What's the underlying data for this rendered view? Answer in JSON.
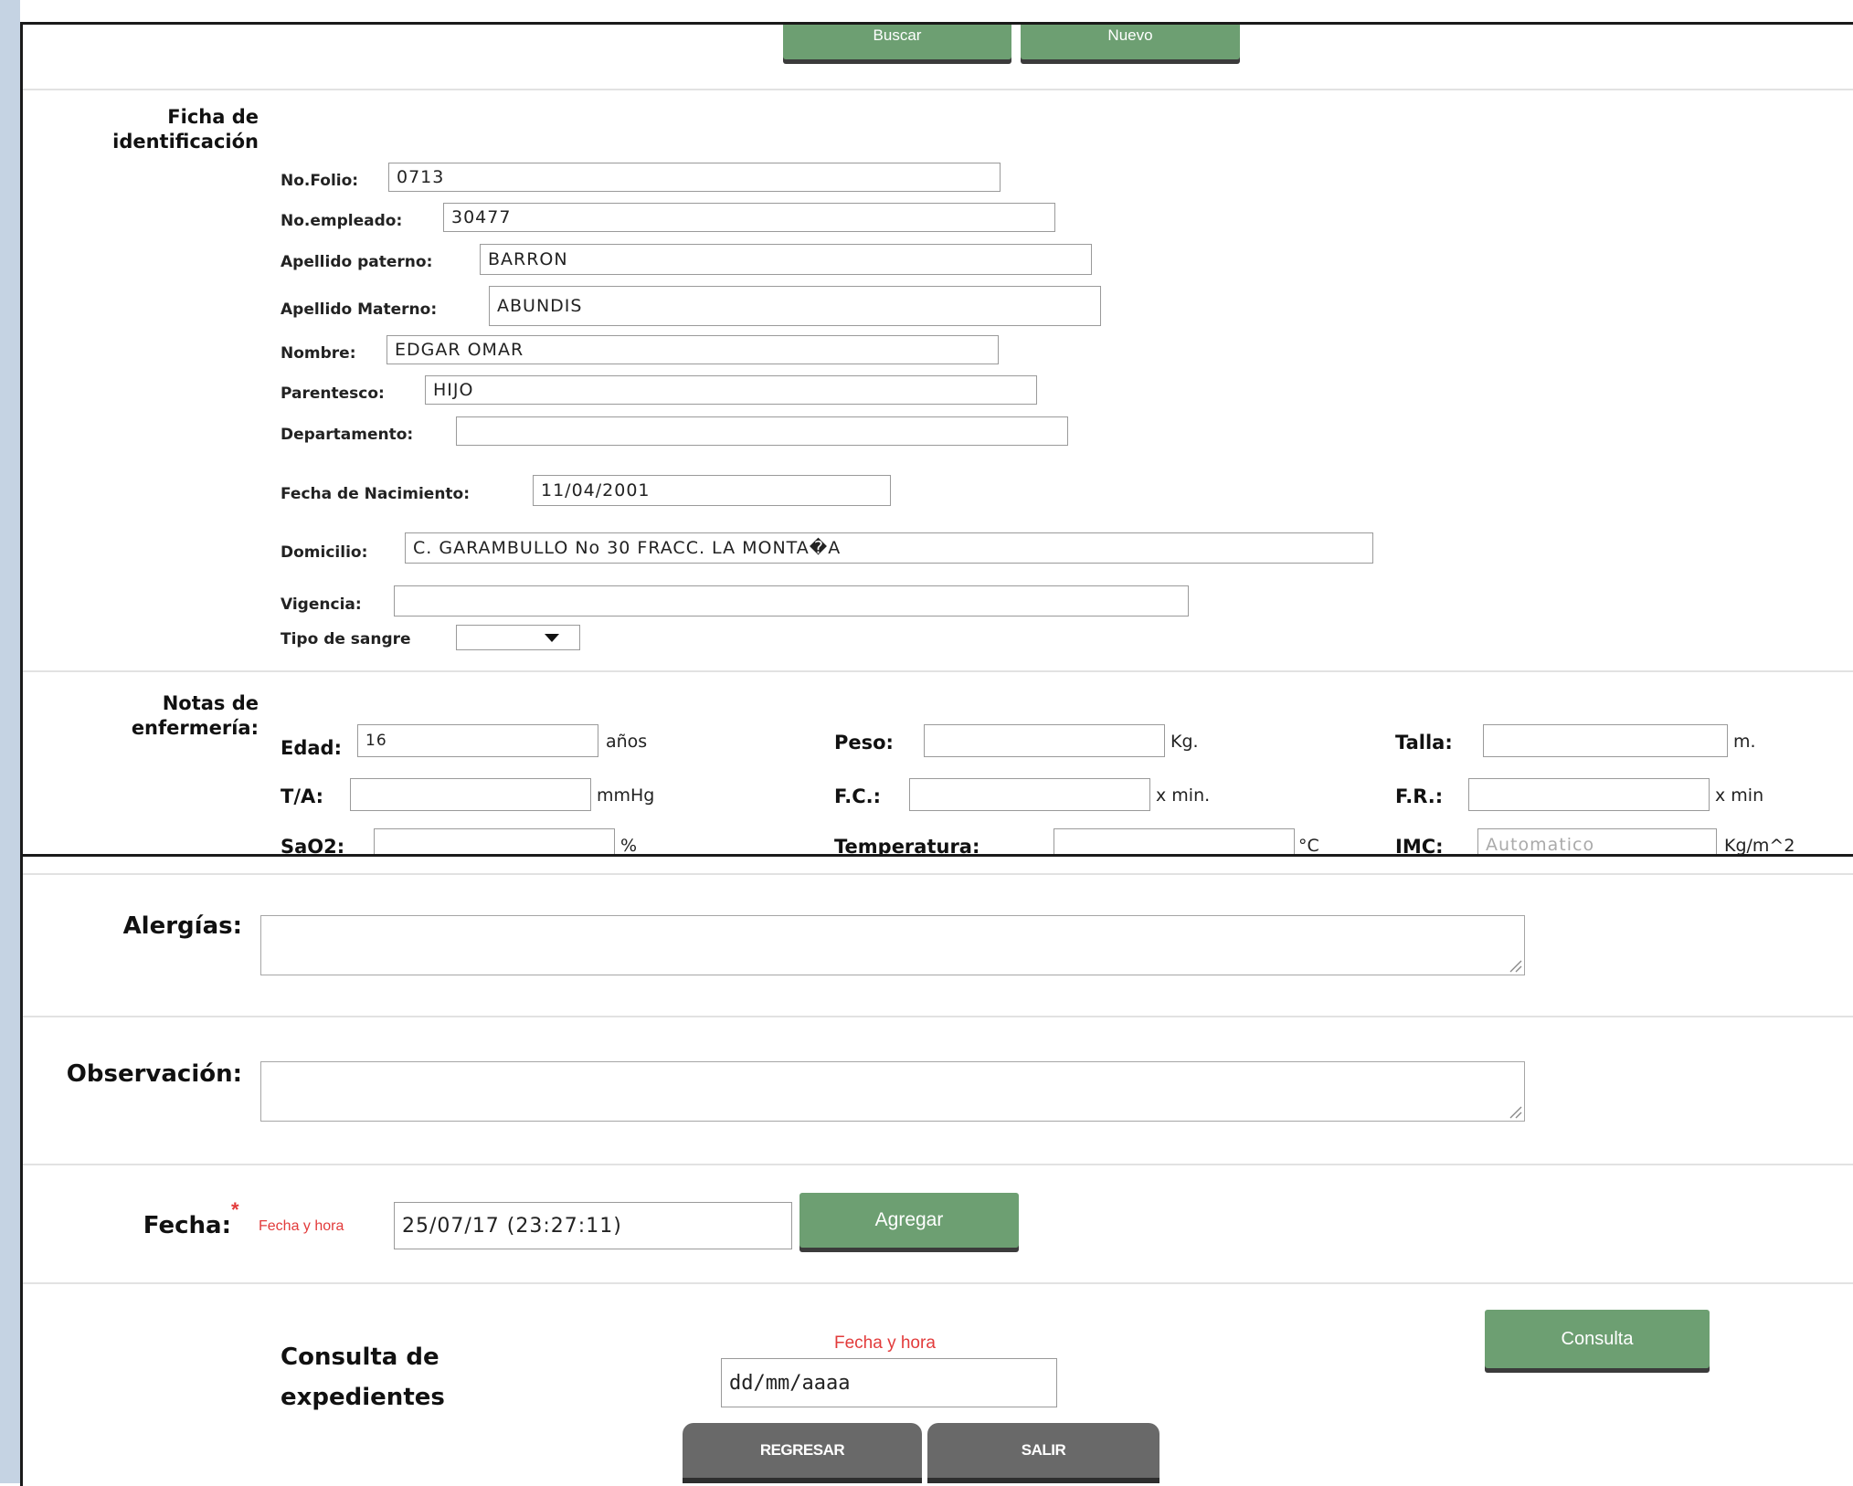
{
  "toolbar": {
    "buscar_label": "Buscar",
    "nuevo_label": "Nuevo"
  },
  "ficha": {
    "heading_line1": "Ficha de",
    "heading_line2": "identificación",
    "fields": {
      "folio": {
        "label": "No.Folio:",
        "value": "0713"
      },
      "empleado": {
        "label": "No.empleado:",
        "value": "30477"
      },
      "paterno": {
        "label": "Apellido paterno:",
        "value": "BARRON"
      },
      "materno": {
        "label": "Apellido Materno:",
        "value": "ABUNDIS"
      },
      "nombre": {
        "label": "Nombre:",
        "value": "EDGAR OMAR"
      },
      "parentesco": {
        "label": "Parentesco:",
        "value": "HIJO"
      },
      "departamento": {
        "label": "Departamento:",
        "value": ""
      },
      "nacimiento": {
        "label": "Fecha de Nacimiento:",
        "value": "11/04/2001"
      },
      "domicilio": {
        "label": "Domicilio:",
        "value": "C. GARAMBULLO No 30 FRACC. LA MONTA�A"
      },
      "vigencia": {
        "label": "Vigencia:",
        "value": ""
      },
      "sangre": {
        "label": "Tipo de sangre",
        "value": ""
      }
    }
  },
  "notas": {
    "heading_line1": "Notas de",
    "heading_line2": "enfermería:",
    "edad": {
      "label": "Edad:",
      "value": "16",
      "unit": "años"
    },
    "peso": {
      "label": "Peso:",
      "value": "",
      "unit": "Kg."
    },
    "talla": {
      "label": "Talla:",
      "value": "",
      "unit": "m."
    },
    "ta": {
      "label": "T/A:",
      "value": "",
      "unit": "mmHg"
    },
    "fc": {
      "label": "F.C.:",
      "value": "",
      "unit": "x min."
    },
    "fr": {
      "label": "F.R.:",
      "value": "",
      "unit": "x min"
    },
    "sao2": {
      "label": "SaO2:",
      "value": "",
      "unit": "%"
    },
    "temperatura": {
      "label": "Temperatura:",
      "value": "",
      "unit": "°C"
    },
    "imc": {
      "label": "IMC:",
      "placeholder": "Automatico",
      "unit": "Kg/m^2"
    }
  },
  "alergias": {
    "label": "Alergías:",
    "value": ""
  },
  "observacion": {
    "label": "Observación:",
    "value": ""
  },
  "fecha": {
    "label": "Fecha:",
    "required_mark": "*",
    "hint": "Fecha y hora",
    "value": "25/07/17 (23:27:11)",
    "agregar_label": "Agregar"
  },
  "consulta": {
    "heading_line1": "Consulta de",
    "heading_line2": "expedientes",
    "hint": "Fecha y hora",
    "date_value": "dd/mm/aaaa",
    "button_label": "Consulta"
  },
  "footer": {
    "regresar_label": "REGRESAR",
    "salir_label": "SALIR"
  },
  "colors": {
    "green_button": "#6d9f72",
    "dark_button": "#696969",
    "sidebar": "#c5d3e3",
    "required": "#e23b3b"
  }
}
